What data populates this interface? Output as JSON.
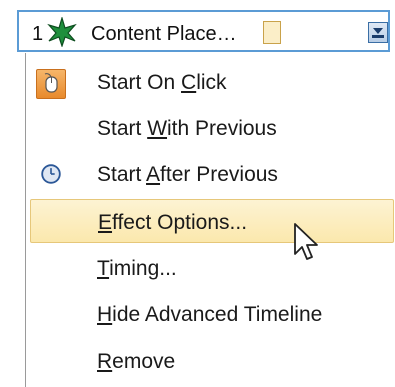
{
  "header": {
    "number": "1",
    "label": "Content Place…",
    "star_color": "#1e8f3c",
    "timing_bar_color": "#fbeec8",
    "dropdown_icon": "chevron-down-icon"
  },
  "menu": {
    "items": [
      {
        "id": "start-on-click",
        "pre": "Start On ",
        "key": "C",
        "post": "lick",
        "icon": "mouse-icon",
        "highlighted": false
      },
      {
        "id": "start-with-previous",
        "pre": "Start ",
        "key": "W",
        "post": "ith Previous",
        "icon": "",
        "highlighted": false
      },
      {
        "id": "start-after-previous",
        "pre": "Start ",
        "key": "A",
        "post": "fter Previous",
        "icon": "clock-icon",
        "highlighted": false
      },
      {
        "id": "effect-options",
        "pre": "",
        "key": "E",
        "post": "ffect Options...",
        "icon": "",
        "highlighted": true
      },
      {
        "id": "timing",
        "pre": "",
        "key": "T",
        "post": "iming...",
        "icon": "",
        "highlighted": false
      },
      {
        "id": "hide-advanced-timeline",
        "pre": "",
        "key": "H",
        "post": "ide Advanced Timeline",
        "icon": "",
        "highlighted": false
      },
      {
        "id": "remove",
        "pre": "",
        "key": "R",
        "post": "emove",
        "icon": "",
        "highlighted": false
      }
    ],
    "highlight_color": "#fbe8ad",
    "accent_color": "#5b9bd5"
  }
}
